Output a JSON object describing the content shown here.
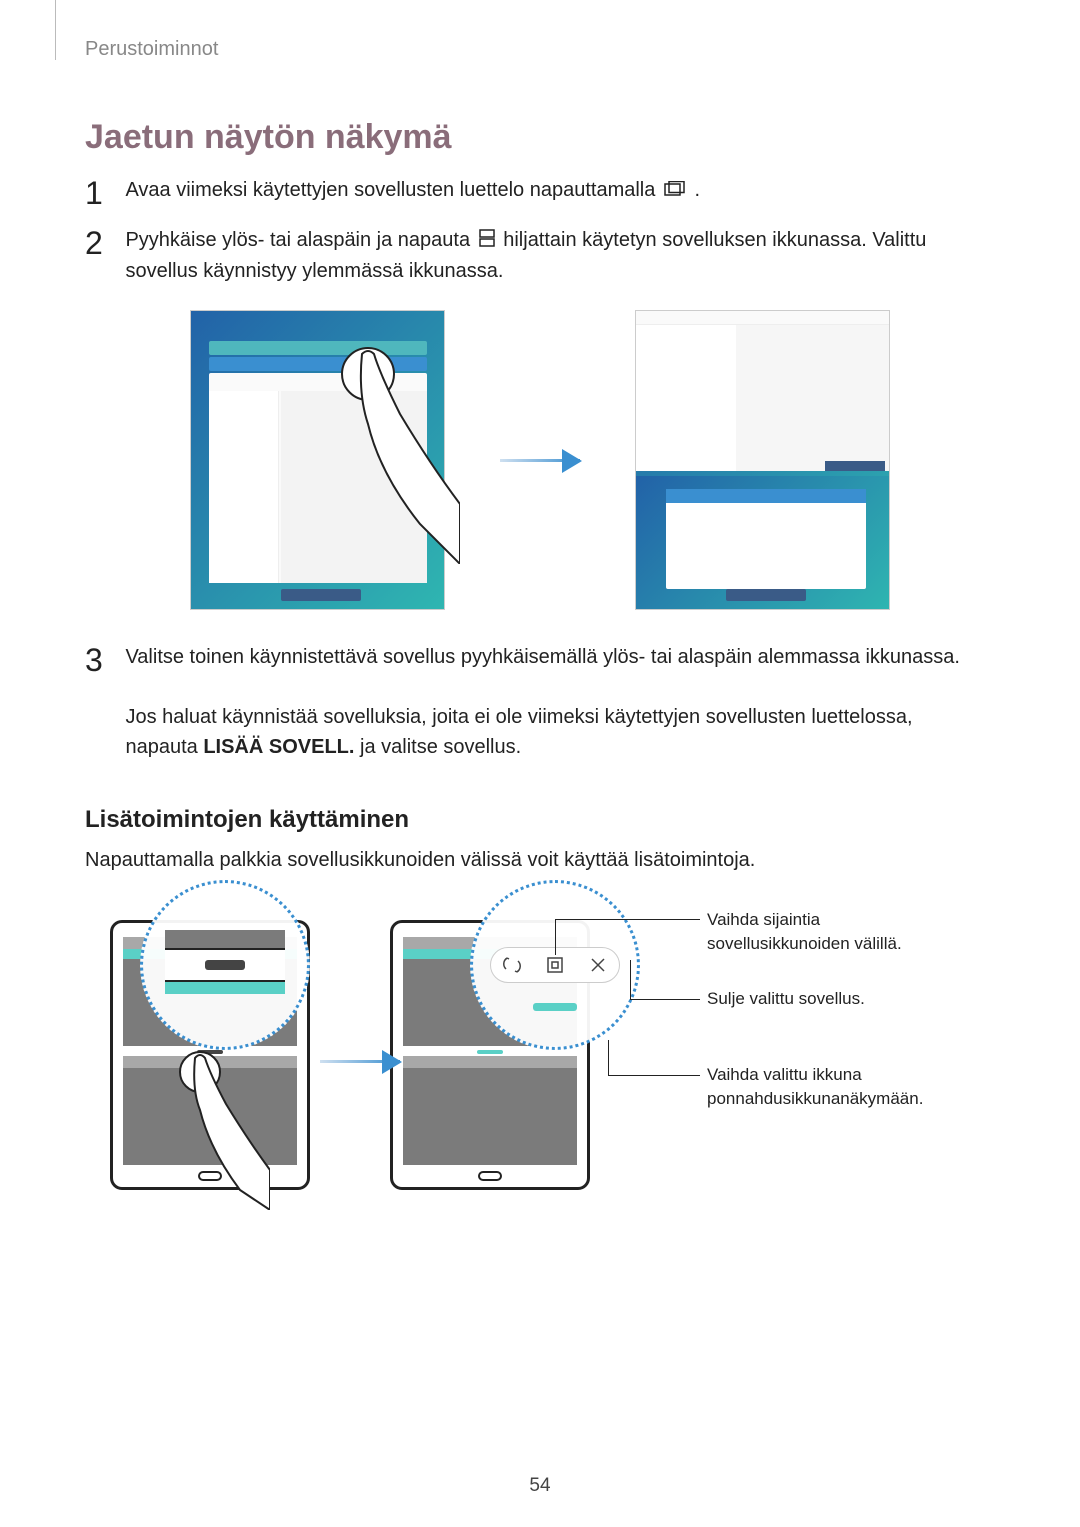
{
  "breadcrumb": "Perustoiminnot",
  "section_title": "Jaetun näytön näkymä",
  "steps": {
    "s1": {
      "num": "1",
      "text_a": "Avaa viimeksi käytettyjen sovellusten luettelo napauttamalla ",
      "text_b": "."
    },
    "s2": {
      "num": "2",
      "text_a": "Pyyhkäise ylös- tai alaspäin ja napauta ",
      "text_b": " hiljattain käytetyn sovelluksen ikkunassa. Valittu sovellus käynnistyy ylemmässä ikkunassa."
    },
    "s3": {
      "num": "3",
      "text_a": "Valitse toinen käynnistettävä sovellus pyyhkäisemällä ylös- tai alaspäin alemmassa ikkunassa.",
      "text_b": "Jos haluat käynnistää sovelluksia, joita ei ole viimeksi käytettyjen sovellusten luettelossa, napauta ",
      "bold": "LISÄÄ SOVELL.",
      "text_c": " ja valitse sovellus."
    }
  },
  "sub_title": "Lisätoimintojen käyttäminen",
  "sub_para": "Napauttamalla palkkia sovellusikkunoiden välissä voit käyttää lisätoimintoja.",
  "callouts": {
    "c1": "Vaihda sijaintia sovellusikkunoiden välillä.",
    "c2": "Sulje valittu sovellus.",
    "c3": "Vaihda valittu ikkuna ponnahdusikkunanäkymään."
  },
  "page_num": "54"
}
